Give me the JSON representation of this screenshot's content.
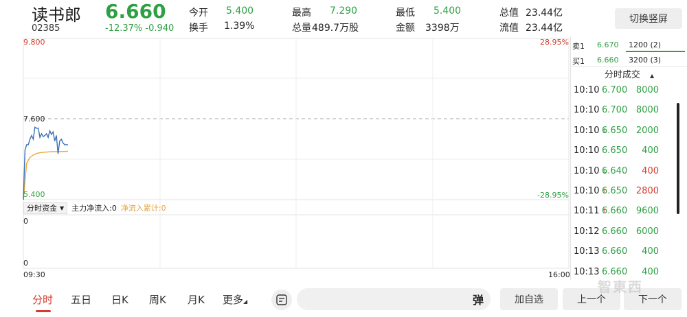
{
  "header": {
    "name": "读书郎",
    "code": "02385",
    "price": "6.660",
    "change_pct": "-12.37%",
    "change_amt": "-0.940",
    "stats": [
      {
        "label": "今开",
        "value": "5.400",
        "color": "green"
      },
      {
        "label": "换手",
        "value": "1.39%",
        "color": "dark"
      },
      {
        "label": "最高",
        "value": "7.290",
        "color": "green"
      },
      {
        "label": "总量",
        "value": "489.7万股",
        "color": "dark"
      },
      {
        "label": "最低",
        "value": "5.400",
        "color": "green"
      },
      {
        "label": "金额",
        "value": "3398万",
        "color": "dark"
      },
      {
        "label": "总值",
        "value": "23.44亿",
        "color": "dark"
      },
      {
        "label": "流值",
        "value": "23.44亿",
        "color": "dark"
      }
    ],
    "switch_label": "切换竖屏"
  },
  "chart": {
    "y_top": "9.800",
    "y_mid": "7.600",
    "y_bottom": "5.400",
    "pct_top": "28.95%",
    "pct_bottom": "-28.95%",
    "fund_zero_top": "0",
    "fund_zero_bottom": "0",
    "time_start": "09:30",
    "time_end": "16:00",
    "fund_selector": "分时资金",
    "fund_main": "主力净流入:0",
    "fund_cum": "净流入累计:0"
  },
  "chart_data": {
    "type": "line",
    "ylim": [
      5.4,
      9.8
    ],
    "reference_price": 7.6,
    "time_range": [
      "09:30",
      "16:00"
    ],
    "series": [
      {
        "name": "price",
        "color": "#3b6fb6",
        "x_min": [
          0,
          1,
          2,
          3,
          4,
          5,
          6,
          7,
          8,
          9,
          10,
          11,
          12,
          13,
          14,
          15,
          16,
          17,
          18,
          19,
          20,
          21,
          22,
          23,
          24,
          25,
          26,
          27
        ],
        "values": [
          5.4,
          6.75,
          6.9,
          6.9,
          7.05,
          7.15,
          7.05,
          7.38,
          7.35,
          7.35,
          7.1,
          7.2,
          7.12,
          7.15,
          7.2,
          7.1,
          7.28,
          7.18,
          7.25,
          7.0,
          7.15,
          6.65,
          7.0,
          7.05,
          6.95,
          6.9,
          6.9,
          6.9
        ]
      },
      {
        "name": "avg",
        "color": "#f0a830",
        "x_min": [
          0,
          2,
          4,
          6,
          8,
          10,
          14,
          18,
          22,
          27
        ],
        "values": [
          5.4,
          6.4,
          6.55,
          6.62,
          6.66,
          6.68,
          6.7,
          6.71,
          6.71,
          6.72
        ]
      }
    ]
  },
  "orderbook": [
    {
      "side": "卖1",
      "price": "6.670",
      "vol": "1200 (2)",
      "bar_color": "#d93a2b"
    },
    {
      "side": "买1",
      "price": "6.660",
      "vol": "3200 (3)",
      "bar_color": "#2ea043"
    }
  ],
  "trades_title": "分时成交",
  "trades": [
    {
      "time": "10:10",
      "price": "6.700",
      "arrow": "",
      "vol": "8000",
      "vol_color": "green"
    },
    {
      "time": "10:10",
      "price": "6.700",
      "arrow": "",
      "vol": "8000",
      "vol_color": "green"
    },
    {
      "time": "10:10",
      "price": "6.650",
      "arrow": "↓",
      "vol": "2000",
      "vol_color": "green"
    },
    {
      "time": "10:10",
      "price": "6.650",
      "arrow": "",
      "vol": "400",
      "vol_color": "green"
    },
    {
      "time": "10:10",
      "price": "6.640",
      "arrow": "↓",
      "vol": "400",
      "vol_color": "red"
    },
    {
      "time": "10:10",
      "price": "6.650",
      "arrow": "↑",
      "vol": "2800",
      "vol_color": "red"
    },
    {
      "time": "10:11",
      "price": "6.660",
      "arrow": "↑",
      "vol": "9600",
      "vol_color": "green"
    },
    {
      "time": "10:12",
      "price": "6.660",
      "arrow": "",
      "vol": "6000",
      "vol_color": "green"
    },
    {
      "time": "10:13",
      "price": "6.660",
      "arrow": "",
      "vol": "400",
      "vol_color": "green"
    },
    {
      "time": "10:13",
      "price": "6.660",
      "arrow": "",
      "vol": "400",
      "vol_color": "green"
    }
  ],
  "tabs": [
    "分时",
    "五日",
    "日K",
    "周K",
    "月K",
    "更多"
  ],
  "toolbar": {
    "danmu": "弹",
    "add_watch": "加自选",
    "prev": "上一个",
    "next": "下一个"
  },
  "watermark": "智東西",
  "colors": {
    "up": "#d93a2b",
    "down": "#2ea043",
    "price_line": "#3b6fb6",
    "avg_line": "#f0a830"
  }
}
